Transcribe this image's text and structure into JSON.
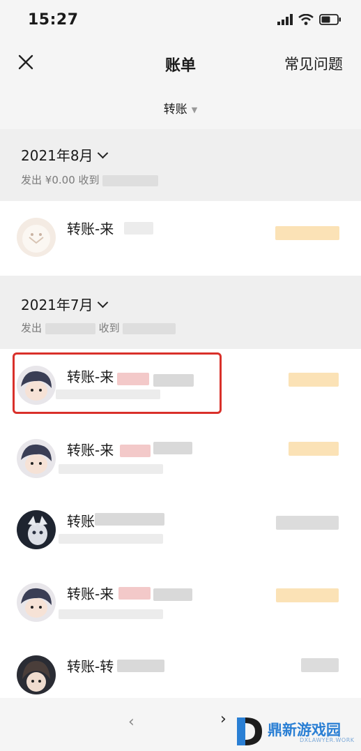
{
  "status_bar": {
    "time": "15:27"
  },
  "nav": {
    "title": "账单",
    "faq_label": "常见问题"
  },
  "filter": {
    "label": "转账"
  },
  "months": [
    {
      "title": "2021年8月",
      "summary_out_label": "发出",
      "summary_out_value": "¥0.00",
      "summary_in_label": "收到"
    },
    {
      "title": "2021年7月",
      "summary_out_label": "发出",
      "summary_in_label": "收到"
    }
  ],
  "transactions": [
    {
      "title": "转账-来"
    },
    {
      "title": "转账-来"
    },
    {
      "title": "转账-来"
    },
    {
      "title": "转账"
    },
    {
      "title": "转账-来"
    },
    {
      "title": "转账-转"
    }
  ],
  "watermark": {
    "brand": "鼎新游戏园",
    "sub": "DXLAWYER.WORK"
  },
  "colors": {
    "highlight_border": "#d9302a",
    "background": "#f5f5f5",
    "watermark": "#2a7fd4"
  }
}
